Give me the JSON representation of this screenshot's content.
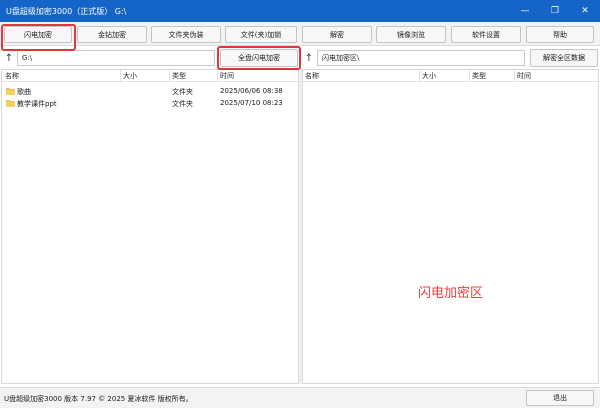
{
  "window": {
    "title": "U盘超级加密3000（正式版） G:\\",
    "controls": {
      "minimize": "—",
      "restore": "❐",
      "close": "✕"
    }
  },
  "toolbar": {
    "buttons": [
      "闪电加密",
      "金钻加密",
      "文件夹伪装",
      "文件(夹)加锁",
      "解密",
      "镜像浏览",
      "软件设置",
      "帮助"
    ]
  },
  "left": {
    "up_label": "↑",
    "path": "G:\\",
    "action_button": "全盘闪电加密",
    "columns": [
      "名称",
      "大小",
      "类型",
      "时间"
    ],
    "files": [
      {
        "name": "歌曲",
        "size": "",
        "type": "文件夹",
        "time": "2025/06/06 08:38",
        "icon": "folder-icon"
      },
      {
        "name": "教学课件ppt",
        "size": "",
        "type": "文件夹",
        "time": "2025/07/10 08:23",
        "icon": "folder-icon"
      }
    ]
  },
  "right": {
    "up_label": "↑",
    "path": "闪电加密区\\",
    "action_button": "解密全区数据",
    "columns": [
      "名称",
      "大小",
      "类型",
      "时间"
    ],
    "watermark": "闪电加密区"
  },
  "status": {
    "text": "U盘超级加密3000 版本 7.97 © 2025 夏冰软件 版权所有。",
    "exit_button": "退出"
  },
  "colors": {
    "titlebar": "#1565c8",
    "highlight": "#e2363f",
    "watermark": "#e8413b",
    "folder": "#f2c14e"
  }
}
